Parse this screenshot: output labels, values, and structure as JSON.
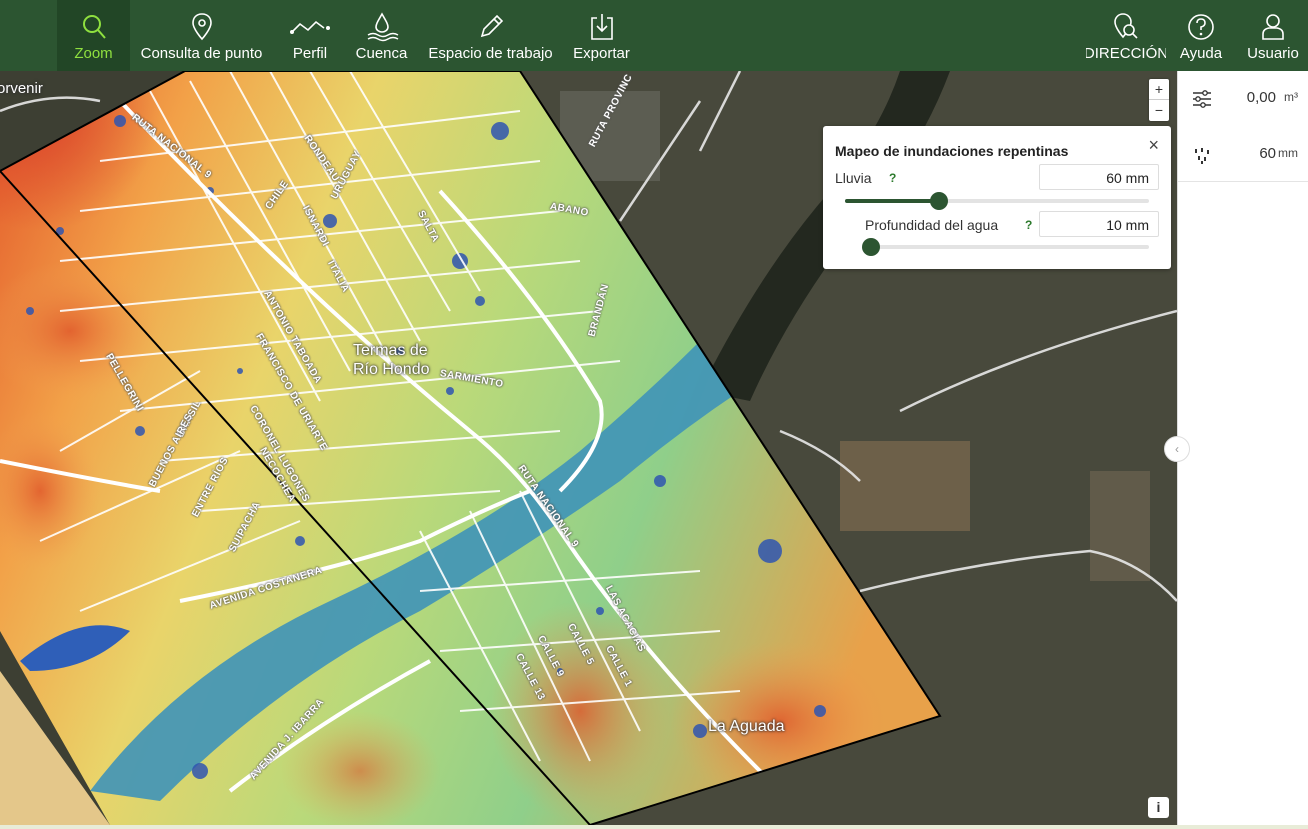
{
  "toolbar": {
    "tools": [
      {
        "label": "Zoom",
        "icon": "search-icon"
      },
      {
        "label": "Consulta de punto",
        "icon": "map-pin-icon"
      },
      {
        "label": "Perfil",
        "icon": "profile-line-icon"
      },
      {
        "label": "Cuenca",
        "icon": "water-drop-icon"
      },
      {
        "label": "Espacio de trabajo",
        "icon": "pencil-icon"
      },
      {
        "label": "Exportar",
        "icon": "download-icon"
      }
    ],
    "right_tools": [
      {
        "label": "DIRECCIÓN",
        "icon": "address-search-icon"
      },
      {
        "label": "Ayuda",
        "icon": "help-icon"
      },
      {
        "label": "Usuario",
        "icon": "user-icon"
      }
    ]
  },
  "map": {
    "street_labels": [
      "RUTA NACIONAL 9",
      "RONDEAU",
      "URUGUAY",
      "CHILE",
      "ISNARDI",
      "SALTA",
      "ABANO",
      "ITALIA",
      "ANTONIO TABOADA",
      "FRANCISCO DE URIARTE",
      "CORONEL LUGONES",
      "NECOCHEA",
      "BRASIL",
      "BUENOS AIRES",
      "ENTRE RÍOS",
      "SUIPACHA",
      "PELLEGRINI",
      "SARMIENTO",
      "BRANDÁN",
      "RUTA PROVINC",
      "RUTA NACIONAL 9",
      "AVENIDA COSTANERA",
      "LAS ACACIAS",
      "CALLE 5",
      "CALLE 9",
      "CALLE 13",
      "CALLE 1",
      "AVENIDA J. IBARRA"
    ],
    "place_labels": [
      "Termas de\nRío Hondo",
      "La Aguada",
      "orvenir"
    ],
    "zoom_in": "+",
    "zoom_out": "−",
    "info": "i"
  },
  "popup": {
    "title": "Mapeo de inundaciones repentinas",
    "close": "×",
    "rain_label": "Lluvia",
    "rain_value": "60 mm",
    "rain_level": 0.31,
    "depth_label": "Profundidad del agua",
    "depth_value": "10 mm",
    "depth_level": 0.0,
    "help": "?"
  },
  "panel": {
    "volume_value": "0,00",
    "volume_unit": "m³",
    "rain_value": "60",
    "rain_unit": "mm",
    "collapse": "‹"
  }
}
